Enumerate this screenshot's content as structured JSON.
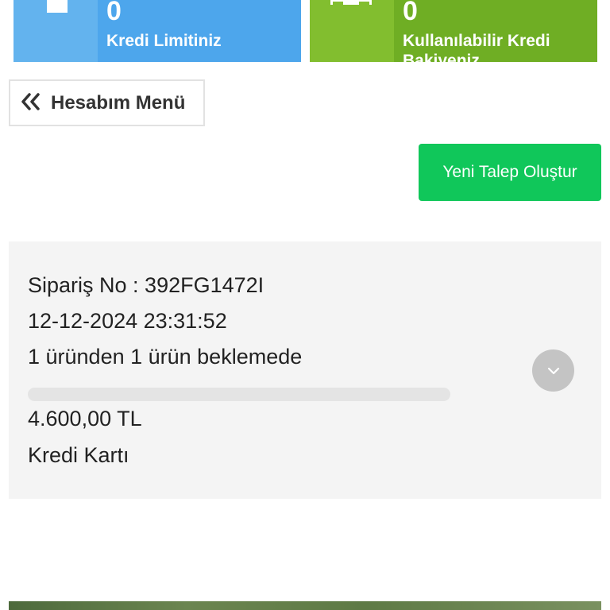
{
  "stats": {
    "credit_limit": {
      "value": "0",
      "label": "Kredi Limitiniz",
      "icon": "star-icon",
      "color": "#55acee"
    },
    "available_credit": {
      "value": "0",
      "label": "Kullanılabilir Kredi Bakiyeniz",
      "icon": "credit-card-icon",
      "color": "#77b82a"
    }
  },
  "menu_button": {
    "icon": "double-chevron-left-icon",
    "label": "Hesabım Menü"
  },
  "new_request_button": {
    "label": "Yeni Talep Oluştur",
    "color": "#10c75a"
  },
  "order": {
    "order_no": "Sipariş No : 392FG1472I",
    "datetime": "12-12-2024 23:31:52",
    "status": "1 üründen 1 ürün beklemede",
    "progress": 0,
    "amount": "4.600,00 TL",
    "payment_method": "Kredi Kartı",
    "expand_icon": "chevron-down-icon"
  }
}
